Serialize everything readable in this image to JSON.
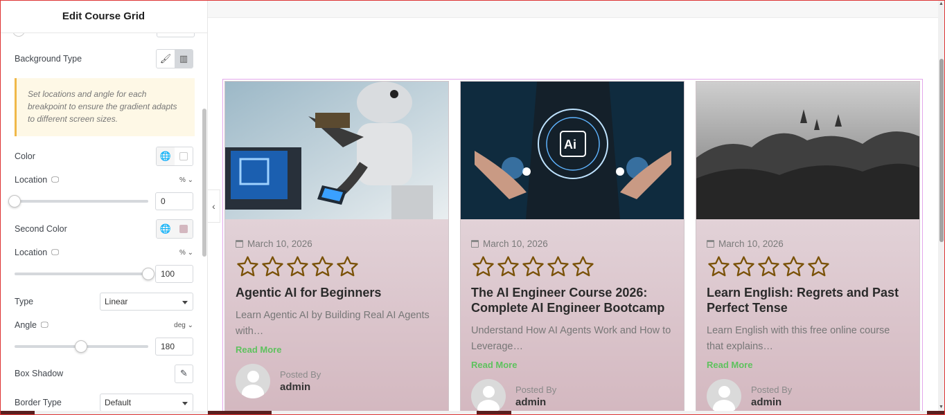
{
  "panel": {
    "title": "Edit Course Grid",
    "background_type_label": "Background Type",
    "notice": "Set locations and angle for each breakpoint to ensure the gradient adapts to different screen sizes.",
    "color_label": "Color",
    "location_label": "Location",
    "location_unit": "% ⌄",
    "location_value": "0",
    "second_color_label": "Second Color",
    "location2_label": "Location",
    "location2_unit": "% ⌄",
    "location2_value": "100",
    "type_label": "Type",
    "type_value": "Linear",
    "angle_label": "Angle",
    "angle_unit": "deg ⌄",
    "angle_value": "180",
    "box_shadow_label": "Box Shadow",
    "border_type_label": "Border Type",
    "border_type_value": "Default",
    "second_color_hex": "#d3b7bf",
    "collapse_glyph": "‹"
  },
  "cards": [
    {
      "date": "March 10, 2026",
      "title": "Agentic AI for Beginners",
      "excerpt": "Learn Agentic AI by Building Real AI Agents with…",
      "read_more": "Read More",
      "posted_by": "Posted By",
      "author": "admin",
      "rating": 0
    },
    {
      "date": "March 10, 2026",
      "title": "The AI Engineer Course 2026: Complete AI Engineer Bootcamp",
      "excerpt": "Understand How AI Agents Work and How to Leverage…",
      "read_more": "Read More",
      "posted_by": "Posted By",
      "author": "admin",
      "rating": 0
    },
    {
      "date": "March 10, 2026",
      "title": "Learn English: Regrets and Past Perfect Tense",
      "excerpt": "Learn English with this free online course that explains…",
      "read_more": "Read More",
      "posted_by": "Posted By",
      "author": "admin",
      "rating": 0
    }
  ],
  "colors": {
    "accent_green": "#5ec25e",
    "star": "#7a5208",
    "grid_outline": "#e3a6ea"
  }
}
